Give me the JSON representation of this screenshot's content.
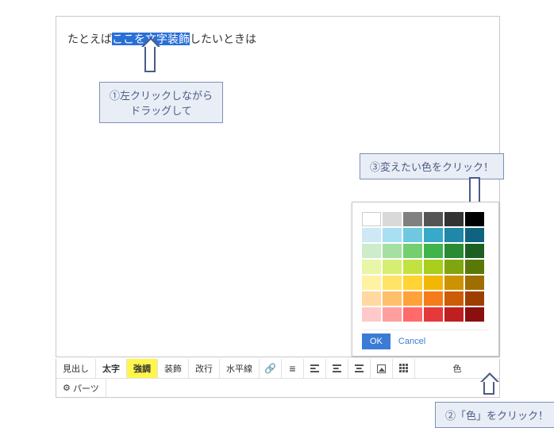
{
  "editor": {
    "before": "たとえば",
    "selected": "ここを文字装飾",
    "after": "したいときは"
  },
  "callouts": {
    "step1_l1": "①左クリックしながら",
    "step1_l2": "ドラッグして",
    "step2": "②「色」をクリック！",
    "step3": "③変えたい色をクリック！"
  },
  "picker": {
    "ok": "OK",
    "cancel": "Cancel",
    "colors": [
      "#ffffff",
      "#d9d9d9",
      "#808080",
      "#555555",
      "#333333",
      "#000000",
      "#cfe8f6",
      "#a9dff3",
      "#6ec9e0",
      "#39a9c9",
      "#1f87a8",
      "#0f6380",
      "#cceccc",
      "#a4e0a4",
      "#73cf6f",
      "#3fb44b",
      "#2b8a34",
      "#1b5f22",
      "#e8f7a6",
      "#d6ef72",
      "#c2e33f",
      "#a7cf1b",
      "#7fa60f",
      "#5a7808",
      "#fff2a3",
      "#ffe468",
      "#ffd433",
      "#f2b705",
      "#cc9200",
      "#9e6e00",
      "#ffd9a0",
      "#ffbf6b",
      "#ffa23a",
      "#f57c1a",
      "#cc5c08",
      "#9e3f02",
      "#ffc9c9",
      "#ff9e9e",
      "#ff6b6b",
      "#e63939",
      "#bf1f1f",
      "#8a0f0f"
    ]
  },
  "toolbar": {
    "row1": {
      "heading": "見出し",
      "bold": "太字",
      "emphasis": "強調",
      "decoration": "装飾",
      "linebreak": "改行",
      "hr": "水平線",
      "color": "色"
    },
    "row2": {
      "parts": "パーツ"
    }
  }
}
